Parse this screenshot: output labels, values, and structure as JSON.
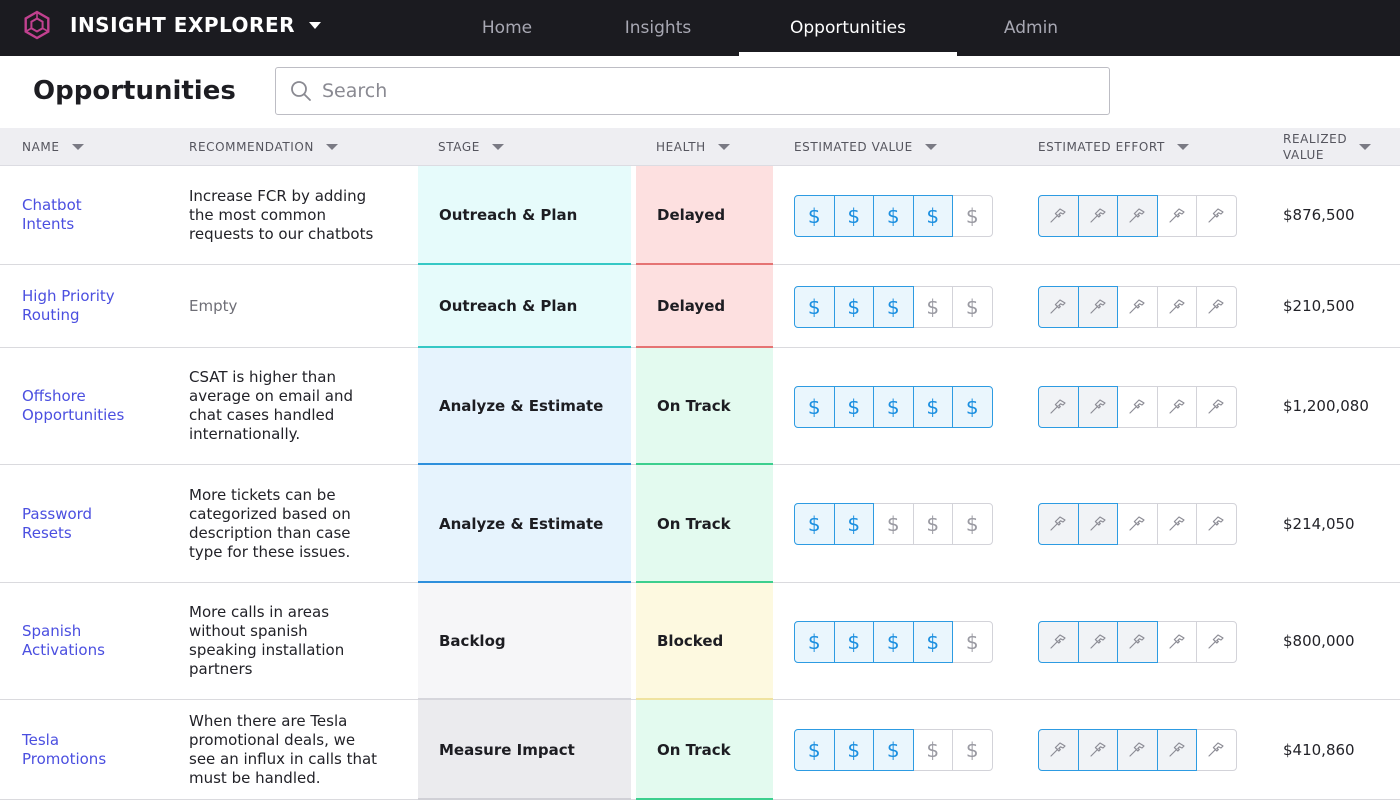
{
  "app": {
    "name": "INSIGHT EXPLORER",
    "accent": "#c1418f"
  },
  "nav": {
    "tabs": [
      {
        "label": "Home",
        "active": false
      },
      {
        "label": "Insights",
        "active": false
      },
      {
        "label": "Opportunities",
        "active": true
      },
      {
        "label": "Admin",
        "active": false
      }
    ]
  },
  "page": {
    "title": "Opportunities"
  },
  "search": {
    "placeholder": "Search",
    "value": ""
  },
  "columns": {
    "name": "NAME",
    "recommendation": "RECOMMENDATION",
    "stage": "STAGE",
    "health": "HEALTH",
    "estimated_value": "ESTIMATED VALUE",
    "estimated_effort": "ESTIMATED EFFORT",
    "realized_value_line1": "REALIZED",
    "realized_value_line2": "VALUE"
  },
  "rating_scale": 5,
  "value_glyph": "$",
  "stage_colors": {
    "Outreach & Plan": {
      "bg": "#e6fbfb",
      "accent": "#35c8c5"
    },
    "Analyze & Estimate": {
      "bg": "#e6f3fd",
      "accent": "#2d8fdc"
    },
    "Backlog": {
      "bg": "#f6f6f8",
      "accent": "#d6d6dc"
    },
    "Measure Impact": {
      "bg": "#ebebee",
      "accent": "#d0d0d6"
    }
  },
  "health_colors": {
    "Delayed": {
      "bg": "#fde0e0",
      "accent": "#e57373"
    },
    "On Track": {
      "bg": "#e3faef",
      "accent": "#3ccf8e"
    },
    "Blocked": {
      "bg": "#fdf9e0",
      "accent": "#efe3a0"
    }
  },
  "rows": [
    {
      "name_line1": "Chatbot",
      "name_line2": "Intents",
      "recommendation": [
        "Increase FCR by adding",
        "the most common",
        "requests to our chatbots"
      ],
      "stage": "Outreach & Plan",
      "health": "Delayed",
      "estimated_value": 4,
      "estimated_effort": 3,
      "realized_value": "$876,500"
    },
    {
      "name_line1": "High Priority",
      "name_line2": "Routing",
      "recommendation": [
        "Empty"
      ],
      "recommendation_empty": true,
      "stage": "Outreach & Plan",
      "health": "Delayed",
      "estimated_value": 3,
      "estimated_effort": 2,
      "realized_value": "$210,500"
    },
    {
      "name_line1": "Offshore",
      "name_line2": "Opportunities",
      "recommendation": [
        "CSAT is higher than",
        "average on email and",
        "chat cases handled",
        "internationally."
      ],
      "stage": "Analyze & Estimate",
      "health": "On Track",
      "estimated_value": 5,
      "estimated_effort": 2,
      "realized_value": "$1,200,080"
    },
    {
      "name_line1": "Password",
      "name_line2": "Resets",
      "recommendation": [
        "More tickets can be",
        "categorized based on",
        "description than case",
        "type for these issues."
      ],
      "stage": "Analyze & Estimate",
      "health": "On Track",
      "estimated_value": 2,
      "estimated_effort": 2,
      "realized_value": "$214,050"
    },
    {
      "name_line1": "Spanish",
      "name_line2": "Activations",
      "recommendation": [
        "More calls in areas",
        "without spanish",
        "speaking installation",
        "partners"
      ],
      "stage": "Backlog",
      "health": "Blocked",
      "estimated_value": 4,
      "estimated_effort": 3,
      "realized_value": "$800,000"
    },
    {
      "name_line1": "Tesla",
      "name_line2": "Promotions",
      "recommendation": [
        "When there are Tesla",
        "promotional deals, we",
        "see an influx in calls that",
        "must be handled."
      ],
      "stage": "Measure Impact",
      "health": "On Track",
      "estimated_value": 3,
      "estimated_effort": 4,
      "realized_value": "$410,860"
    }
  ]
}
